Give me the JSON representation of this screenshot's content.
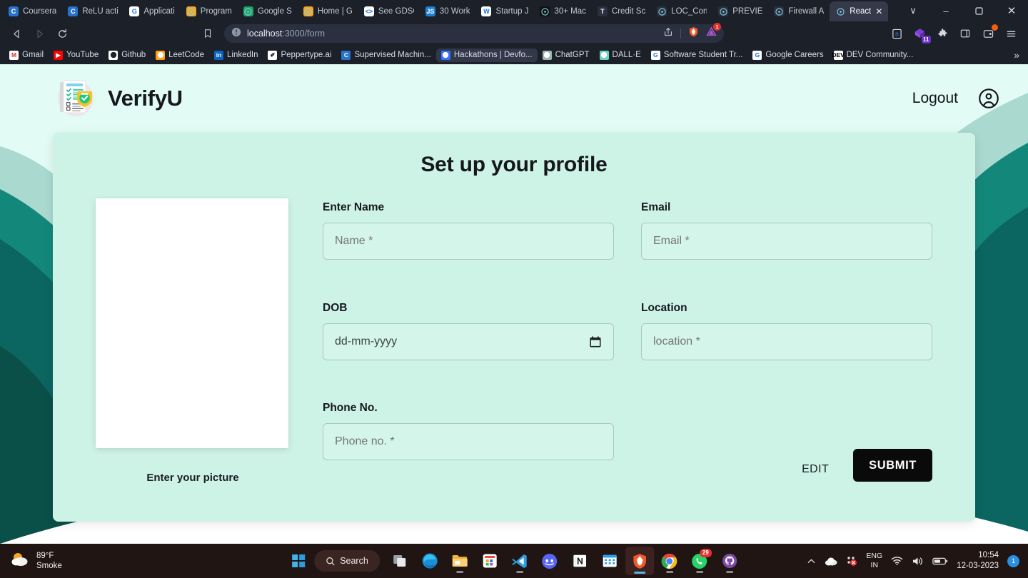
{
  "browser": {
    "tabs": [
      {
        "title": "Coursera",
        "icon": "coursera-icon",
        "color": "#2a73cc",
        "glyph": "C",
        "active": false
      },
      {
        "title": "ReLU acti",
        "icon": "coursera-icon",
        "color": "#2a73cc",
        "glyph": "C",
        "active": false
      },
      {
        "title": "Applicati",
        "icon": "google-icon",
        "color": "#ffffff",
        "glyph": "G",
        "active": false
      },
      {
        "title": "Program",
        "icon": "gfg-icon",
        "color": "#f5a623",
        "glyph": "",
        "active": false
      },
      {
        "title": "Google S",
        "icon": "google-drive-icon",
        "color": "#1fa463",
        "glyph": "",
        "active": false
      },
      {
        "title": "Home | G",
        "icon": "gfg-icon",
        "color": "#f5a623",
        "glyph": "",
        "active": false
      },
      {
        "title": "See GDSC",
        "icon": "code-icon",
        "color": "#ffffff",
        "glyph": "<>",
        "active": false
      },
      {
        "title": "30 Work",
        "icon": "js-icon",
        "color": "#1e7fd4",
        "glyph": "JS",
        "active": false
      },
      {
        "title": "Startup J",
        "icon": "word-icon",
        "color": "#ffffff",
        "glyph": "W",
        "active": false
      },
      {
        "title": "30+ Mac",
        "icon": "video-icon",
        "color": "#111111",
        "glyph": "",
        "active": false
      },
      {
        "title": "Credit Sc",
        "icon": "circle-t-icon",
        "color": "#2b3040",
        "glyph": "T",
        "active": false
      },
      {
        "title": "LOC_Con",
        "icon": "github-icon",
        "color": "#2b3040",
        "glyph": "",
        "active": false
      },
      {
        "title": "PREVIE",
        "icon": "figma-icon",
        "color": "#2b3040",
        "glyph": "",
        "active": false
      },
      {
        "title": "Firewall A",
        "icon": "globe-icon",
        "color": "#2b3040",
        "glyph": "",
        "active": false
      },
      {
        "title": "React",
        "icon": "react-icon",
        "color": "#35394a",
        "glyph": "",
        "active": true
      }
    ],
    "new_tab_label": "+",
    "window_controls": {
      "list": "∨",
      "minimize": "–",
      "maximize": "❐",
      "close": "✕"
    },
    "url_host": "localhost",
    "url_path": ":3000/form",
    "notification_count": "1",
    "extension_badge": "11",
    "bookmarks": [
      {
        "label": "Gmail",
        "icon": "gmail-icon",
        "color": "#ffffff",
        "glyph": "M",
        "fg": "#d93025",
        "active": false
      },
      {
        "label": "YouTube",
        "icon": "youtube-icon",
        "color": "#ff0000",
        "glyph": "▶",
        "fg": "#ffffff",
        "active": false
      },
      {
        "label": "Github",
        "icon": "github-icon",
        "color": "#ffffff",
        "glyph": "",
        "fg": "#1c2029",
        "active": false
      },
      {
        "label": "LeetCode",
        "icon": "leetcode-icon",
        "color": "#ffa116",
        "glyph": "",
        "fg": "#ffffff",
        "active": false
      },
      {
        "label": "LinkedIn",
        "icon": "linkedin-icon",
        "color": "#0a66c2",
        "glyph": "in",
        "fg": "#ffffff",
        "active": false
      },
      {
        "label": "Peppertype.ai",
        "icon": "peppertype-icon",
        "color": "#ffffff",
        "glyph": "✐",
        "fg": "#1c2029",
        "active": false
      },
      {
        "label": "Supervised Machin...",
        "icon": "coursera-icon",
        "color": "#2a73cc",
        "glyph": "C",
        "fg": "#ffffff",
        "active": false
      },
      {
        "label": "Hackathons | Devfo...",
        "icon": "devfolio-icon",
        "color": "#3770ff",
        "glyph": "",
        "fg": "#ffffff",
        "active": true
      },
      {
        "label": "ChatGPT",
        "icon": "chatgpt-icon",
        "color": "#9bb8b0",
        "glyph": "",
        "fg": "#ffffff",
        "active": false
      },
      {
        "label": "DALL·E",
        "icon": "dalle-icon",
        "color": "#6ad1c4",
        "glyph": "",
        "fg": "#ffffff",
        "active": false
      },
      {
        "label": "Software Student Tr...",
        "icon": "google-icon",
        "color": "#ffffff",
        "glyph": "G",
        "fg": "#1a73e8",
        "active": false
      },
      {
        "label": "Google Careers",
        "icon": "google-icon",
        "color": "#ffffff",
        "glyph": "G",
        "fg": "#1a73e8",
        "active": false
      },
      {
        "label": "DEV Community...",
        "icon": "dev-icon",
        "color": "#ffffff",
        "glyph": "DEV",
        "fg": "#000000",
        "active": false
      }
    ],
    "bookmarks_overflow": "»"
  },
  "app": {
    "brand_name": "VerifyU",
    "logout_label": "Logout",
    "card_title": "Set up your profile",
    "photo_label": "Enter your picture",
    "fields": [
      {
        "label": "Enter Name",
        "placeholder": "Name *",
        "value": "",
        "name": "name"
      },
      {
        "label": "Email",
        "placeholder": "Email *",
        "value": "",
        "name": "email"
      },
      {
        "label": "DOB",
        "placeholder": "dd-mm-yyyy",
        "value": "",
        "name": "dob"
      },
      {
        "label": "Location",
        "placeholder": "location *",
        "value": "",
        "name": "location"
      },
      {
        "label": "Phone No.",
        "placeholder": "Phone no. *",
        "value": "",
        "name": "phone"
      }
    ],
    "edit_label": "EDIT",
    "submit_label": "SUBMIT",
    "colors": {
      "card_bg": "#cdf3e7",
      "input_bg": "#d4f5ea",
      "submit_bg": "#0a0a0a",
      "wave_light": "#e2fbf5",
      "wave_mid": "#93ccc0",
      "wave_teal": "#13877a",
      "wave_dark": "#0b6560",
      "wave_darkest": "#0a5b58"
    }
  },
  "taskbar": {
    "weather_temp": "89°F",
    "weather_cond": "Smoke",
    "search_label": "Search",
    "apps": [
      {
        "name": "start-button",
        "icon": "windows-icon",
        "state": ""
      },
      {
        "name": "task-view",
        "icon": "task-view-icon",
        "state": ""
      },
      {
        "name": "edge",
        "icon": "edge-icon",
        "state": ""
      },
      {
        "name": "file-explorer",
        "icon": "file-explorer-icon",
        "state": "open"
      },
      {
        "name": "microsoft-store",
        "icon": "store-icon",
        "state": ""
      },
      {
        "name": "vs-code",
        "icon": "vscode-icon",
        "state": "open"
      },
      {
        "name": "discord",
        "icon": "discord-icon",
        "state": ""
      },
      {
        "name": "notion",
        "icon": "notion-icon",
        "state": ""
      },
      {
        "name": "calendar",
        "icon": "calendar-icon",
        "state": ""
      },
      {
        "name": "brave",
        "icon": "brave-icon",
        "state": "active"
      },
      {
        "name": "chrome",
        "icon": "chrome-icon",
        "state": "open"
      },
      {
        "name": "whatsapp",
        "icon": "whatsapp-icon",
        "state": "open",
        "badge": "29"
      },
      {
        "name": "github-desktop",
        "icon": "github-icon",
        "state": "open"
      }
    ],
    "tray": {
      "language": "ENG",
      "region": "IN",
      "time": "10:54",
      "date": "12-03-2023",
      "notification_count": "1"
    }
  }
}
